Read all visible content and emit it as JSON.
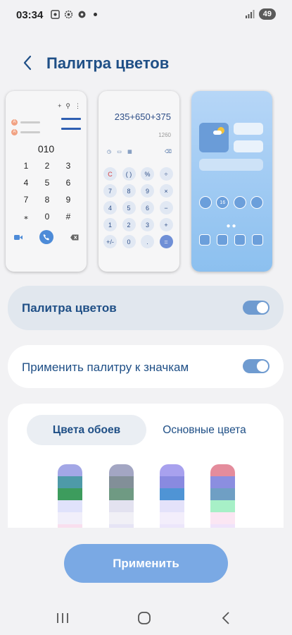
{
  "status_bar": {
    "time": "03:34",
    "battery": "49"
  },
  "header": {
    "title": "Палитра цветов"
  },
  "previews": {
    "dialer": {
      "number": "010",
      "keys": [
        "1",
        "2",
        "3",
        "4",
        "5",
        "6",
        "7",
        "8",
        "9",
        "⁎",
        "0",
        "#"
      ]
    },
    "calculator": {
      "expression": "235+650+375",
      "result": "1260",
      "keys": [
        "C",
        "( )",
        "%",
        "÷",
        "7",
        "8",
        "9",
        "×",
        "4",
        "5",
        "6",
        "−",
        "1",
        "2",
        "3",
        "+",
        "+/-",
        "0",
        ".",
        "="
      ]
    },
    "home": {
      "calendar_day": "16"
    }
  },
  "toggles": {
    "palette": {
      "label": "Палитра цветов",
      "enabled": true
    },
    "apply_to_icons": {
      "label": "Применить палитру к значкам",
      "enabled": true
    }
  },
  "palette_tabs": [
    {
      "label": "Цвета обоев",
      "selected": true
    },
    {
      "label": "Основные цвета",
      "selected": false
    }
  ],
  "swatches": [
    {
      "colors": [
        "#a3a7e6",
        "#4e9aa8",
        "#3d9c5d",
        "#e0e2fb",
        "#f1effa",
        "#f9dfee"
      ]
    },
    {
      "colors": [
        "#a3a6c3",
        "#828f98",
        "#6f9a83",
        "#e3e2f0",
        "#f1f0f6",
        "#e6e4f5"
      ]
    },
    {
      "colors": [
        "#a8a1ee",
        "#898ae0",
        "#4f94d5",
        "#e4e2fa",
        "#f3eefb",
        "#ece6fb"
      ]
    },
    {
      "colors": [
        "#e48c9c",
        "#8b8ee0",
        "#6f9fc4",
        "#a7f0c7",
        "#fbe6f3",
        "#efe3fb"
      ]
    }
  ],
  "apply_button": {
    "label": "Применить"
  },
  "colors": {
    "accent": "#1f4f86",
    "toggle_on": "#6f9bd0",
    "button": "#7aa9e4"
  }
}
